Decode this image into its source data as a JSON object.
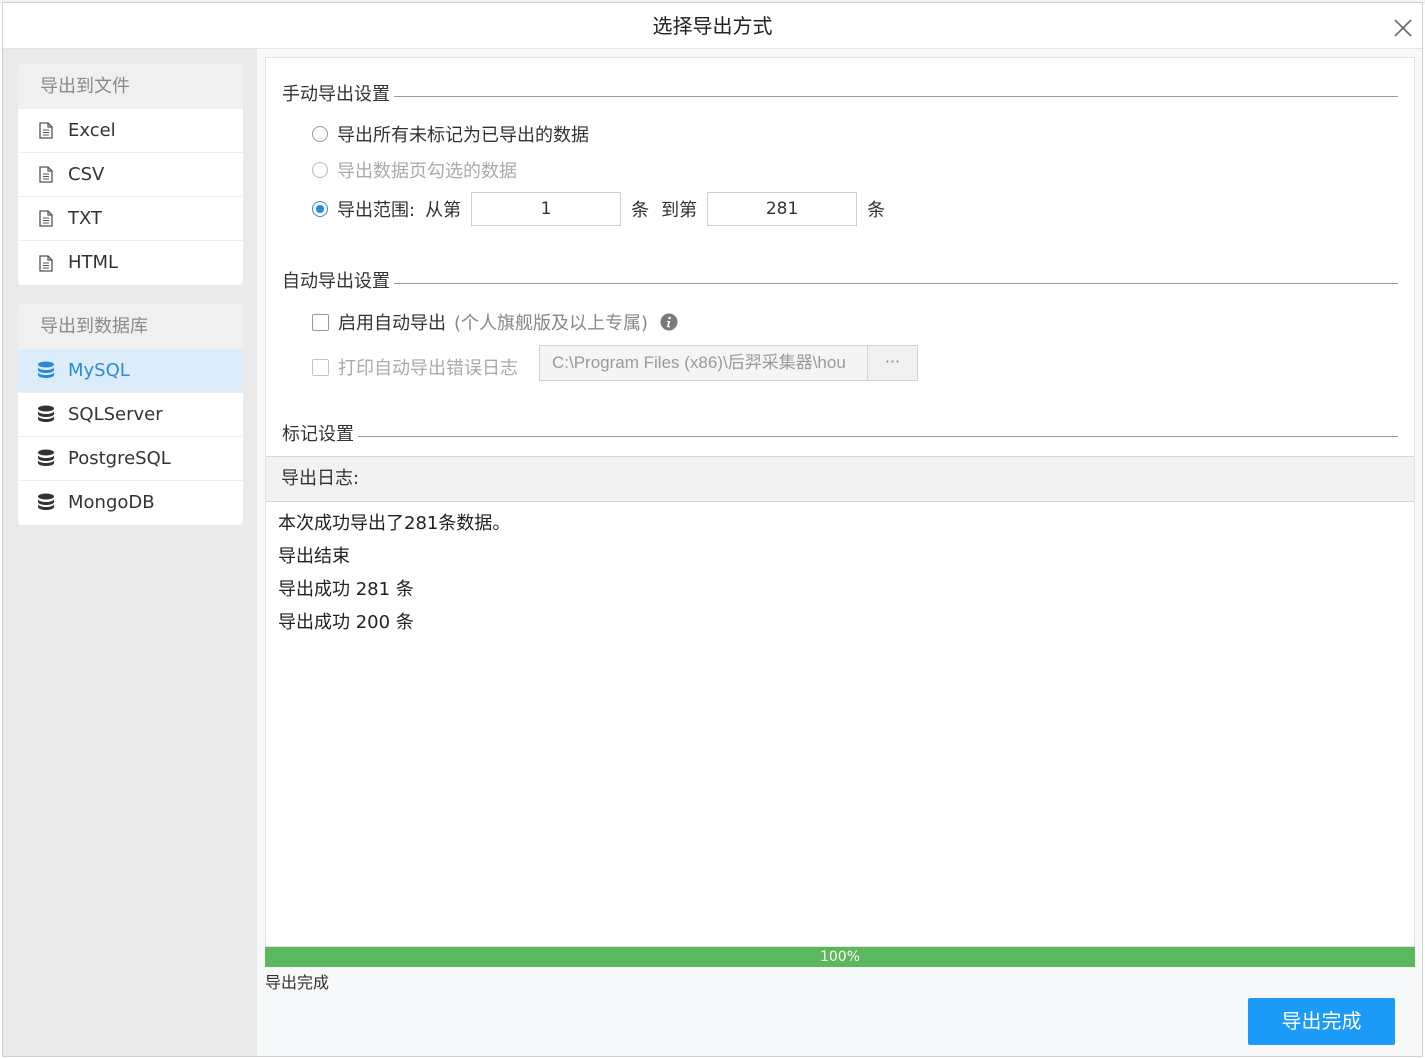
{
  "window": {
    "title": "选择导出方式"
  },
  "sidebar": {
    "file_group": {
      "title": "导出到文件",
      "items": [
        {
          "label": "Excel",
          "icon": "document-icon"
        },
        {
          "label": "CSV",
          "icon": "document-icon"
        },
        {
          "label": "TXT",
          "icon": "document-icon"
        },
        {
          "label": "HTML",
          "icon": "document-icon"
        }
      ]
    },
    "db_group": {
      "title": "导出到数据库",
      "items": [
        {
          "label": "MySQL",
          "icon": "database-icon",
          "selected": true
        },
        {
          "label": "SQLServer",
          "icon": "database-icon"
        },
        {
          "label": "PostgreSQL",
          "icon": "database-icon"
        },
        {
          "label": "MongoDB",
          "icon": "database-icon"
        }
      ]
    }
  },
  "manual": {
    "title": "手动导出设置",
    "opt_all_unmarked": "导出所有未标记为已导出的数据",
    "opt_checked_on_page": "导出数据页勾选的数据",
    "opt_range": "导出范围:",
    "from_label": "从第",
    "from_value": "1",
    "unit_1": "条",
    "to_label": "到第",
    "to_value": "281",
    "unit_2": "条",
    "selected_option": "range"
  },
  "auto": {
    "title": "自动导出设置",
    "enable_label": "启用自动导出",
    "enable_note": "(个人旗舰版及以上专属)",
    "print_log_label": "打印自动导出错误日志",
    "log_path": "C:\\Program Files (x86)\\后羿采集器\\hou",
    "browse_label": "···"
  },
  "mark": {
    "title": "标记设置"
  },
  "log": {
    "header": "导出日志:",
    "lines": [
      "本次成功导出了281条数据。",
      "导出结束",
      "导出成功 281 条",
      "导出成功 200 条"
    ]
  },
  "progress": {
    "percent": 100,
    "label": "100%"
  },
  "status": "导出完成",
  "done_button": "导出完成",
  "colors": {
    "accent": "#2b8ad8",
    "button": "#1b9af7",
    "progress": "#5cb85c",
    "selected_bg": "#dcecf9"
  }
}
